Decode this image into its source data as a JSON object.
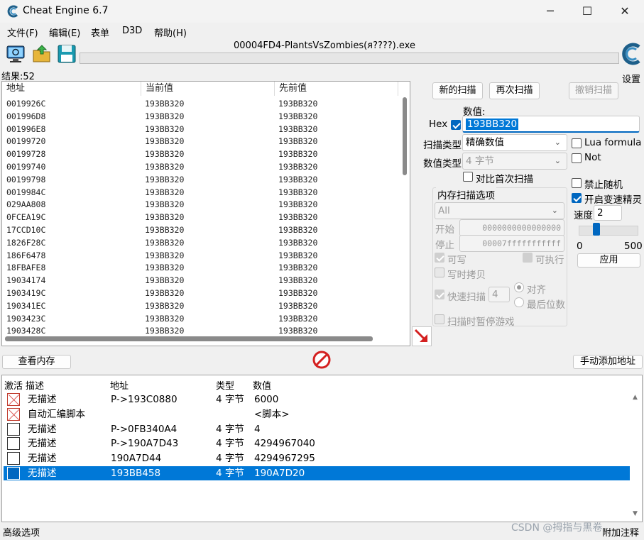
{
  "window": {
    "title": "Cheat Engine 6.7",
    "minimize": "─",
    "maximize": "☐",
    "close": "✕"
  },
  "menu": [
    "文件(F)",
    "编辑(E)",
    "表单",
    "D3D",
    "帮助(H)"
  ],
  "toolbar": {
    "icons": [
      "computer-icon",
      "open-folder-icon",
      "save-disk-icon"
    ]
  },
  "process_title": "00004FD4-PlantsVsZombies(ᴙ????).exe",
  "settings_label": "设置",
  "results_label": "结果:52",
  "results": {
    "columns": [
      "地址",
      "当前值",
      "先前值"
    ],
    "rows": [
      [
        "0019926C",
        "193BB320",
        "193BB320"
      ],
      [
        "001996D8",
        "193BB320",
        "193BB320"
      ],
      [
        "001996E8",
        "193BB320",
        "193BB320"
      ],
      [
        "00199720",
        "193BB320",
        "193BB320"
      ],
      [
        "00199728",
        "193BB320",
        "193BB320"
      ],
      [
        "00199740",
        "193BB320",
        "193BB320"
      ],
      [
        "00199798",
        "193BB320",
        "193BB320"
      ],
      [
        "0019984C",
        "193BB320",
        "193BB320"
      ],
      [
        "029AA808",
        "193BB320",
        "193BB320"
      ],
      [
        "0FCEA19C",
        "193BB320",
        "193BB320"
      ],
      [
        "17CCD10C",
        "193BB320",
        "193BB320"
      ],
      [
        "1826F28C",
        "193BB320",
        "193BB320"
      ],
      [
        "186F6478",
        "193BB320",
        "193BB320"
      ],
      [
        "18FBAFE8",
        "193BB320",
        "193BB320"
      ],
      [
        "19034174",
        "193BB320",
        "193BB320"
      ],
      [
        "1903419C",
        "193BB320",
        "193BB320"
      ],
      [
        "190341EC",
        "193BB320",
        "193BB320"
      ],
      [
        "1903423C",
        "193BB320",
        "193BB320"
      ],
      [
        "1903428C",
        "193BB320",
        "193BB320"
      ]
    ]
  },
  "scan": {
    "new_scan": "新的扫描",
    "next_scan": "再次扫描",
    "undo_scan": "撤销扫描",
    "value_label": "数值:",
    "hex_label": "Hex",
    "value": "193BB320",
    "scan_type_label": "扫描类型",
    "scan_type": "精确数值",
    "value_type_label": "数值类型",
    "value_type": "4 字节",
    "compare_first": "对比首次扫描",
    "lua_formula": "Lua formula",
    "not_label": "Not",
    "no_random": "禁止随机",
    "speedhack": "开启变速精灵",
    "speed_label": "速度",
    "speed_value": "2",
    "slider_min": "0",
    "slider_max": "500",
    "slider_level_fraction": 0.004,
    "apply": "应用"
  },
  "mem_options": {
    "title": "内存扫描选项",
    "region": "All",
    "start_label": "开始",
    "start": "0000000000000000",
    "stop_label": "停止",
    "stop": "00007fffffffffff",
    "writable": "可写",
    "executable": "可执行",
    "copy_on_write": "写时拷贝",
    "fast_scan": "快速扫描",
    "fast_value": "4",
    "align": "对齐",
    "last_digits": "最后位数",
    "pause_game": "扫描时暂停游戏"
  },
  "buttons": {
    "view_memory": "查看内存",
    "add_address": "手动添加地址"
  },
  "address_list": {
    "columns": [
      "激活",
      "描述",
      "地址",
      "类型",
      "数值"
    ],
    "rows": [
      {
        "desc": "无描述",
        "addr": "P->193C0880",
        "type": "4 字节",
        "value": "6000",
        "mark": "x"
      },
      {
        "desc": "自动汇编脚本",
        "addr": "",
        "type": "",
        "value": "<脚本>",
        "mark": "x"
      },
      {
        "desc": "无描述",
        "addr": "P->0FB340A4",
        "type": "4 字节",
        "value": "4",
        "mark": ""
      },
      {
        "desc": "无描述",
        "addr": "P->190A7D43",
        "type": "4 字节",
        "value": "4294967040",
        "mark": ""
      },
      {
        "desc": "无描述",
        "addr": "190A7D44",
        "type": "4 字节",
        "value": "4294967295",
        "mark": ""
      },
      {
        "desc": "无描述",
        "addr": "193BB458",
        "type": "4 字节",
        "value": "190A7D20",
        "mark": "sel"
      }
    ]
  },
  "status": {
    "advanced": "高级选项",
    "extra": "附加注释",
    "watermark": "CSDN @拇指与黑卷"
  },
  "colors": {
    "selection": "#0078d7",
    "accent": "#0067c0"
  }
}
